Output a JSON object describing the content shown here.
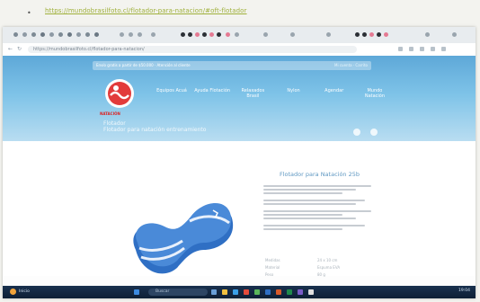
{
  "document": {
    "bullet": "•",
    "link_text": "https://mundobrasilfoto.cl/flotador-para-natacion/#oft-flotador"
  },
  "browser": {
    "address": "https://mundobrasilfoto.cl/flotador-para-natacion/",
    "back_icon": "arrow-left-icon",
    "forward_icon": "arrow-right-icon",
    "reload_icon": "reload-icon"
  },
  "site": {
    "top_strip_left": "Envío gratis a partir de $50.000 · Atención al cliente",
    "top_strip_right": "Mi cuenta · Carrito",
    "logo_text": "NATACIÓN",
    "menu": [
      {
        "label": "Equipos Acuá"
      },
      {
        "label": "Ayuda Flotación"
      },
      {
        "label": "Relaxados Brasil"
      },
      {
        "label": "Nylon"
      },
      {
        "label": "Agendar"
      },
      {
        "label": "Mundo Natación"
      }
    ],
    "hero_title_line1": "Flotador",
    "hero_title_line2": "Flotador para natación entrenamiento",
    "product_title": "Flotador para Natación 25b",
    "spec_labels": [
      "Medidas",
      "Material",
      "Peso",
      "Color"
    ],
    "spec_values": [
      "24 x 10 cm",
      "Espuma EVA",
      "80 g",
      "Azul"
    ]
  },
  "taskbar": {
    "search_placeholder": "Buscar",
    "time": "19:04",
    "start_label": "Inicio"
  },
  "colors": {
    "hero_top": "#5ea8d8",
    "buoy_blue": "#2f6fc4",
    "taskbar": "#19314f",
    "link": "#9fb03a"
  }
}
